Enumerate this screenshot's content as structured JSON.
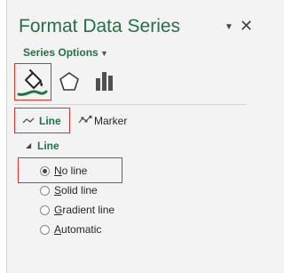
{
  "pane": {
    "title": "Format Data Series",
    "dropdown_icon": "caret-down-icon",
    "close_icon": "close-icon"
  },
  "series_options": {
    "label": "Series Options",
    "caret_icon": "caret-down-icon"
  },
  "category_icons": [
    {
      "name": "fill-and-line-icon",
      "selected": true
    },
    {
      "name": "effects-pentagon-icon",
      "selected": false
    },
    {
      "name": "series-options-bars-icon",
      "selected": false
    }
  ],
  "tabs": {
    "line": {
      "label": "Line",
      "selected": true
    },
    "marker": {
      "label": "Marker",
      "selected": false
    }
  },
  "section": {
    "label": "Line",
    "expanded": true
  },
  "radios": [
    {
      "label": "No line",
      "access_key": "N",
      "rest": "o line",
      "checked": true
    },
    {
      "label": "Solid line",
      "access_key": "S",
      "rest": "olid line",
      "checked": false
    },
    {
      "label": "Gradient line",
      "access_key": "G",
      "rest": "radient line",
      "checked": false
    },
    {
      "label": "Automatic",
      "access_key": "A",
      "rest": "utomatic",
      "checked": false
    }
  ],
  "colors": {
    "accent_green": "#217346",
    "highlight_red": "#e0302a",
    "background": "#f3f3f3"
  }
}
